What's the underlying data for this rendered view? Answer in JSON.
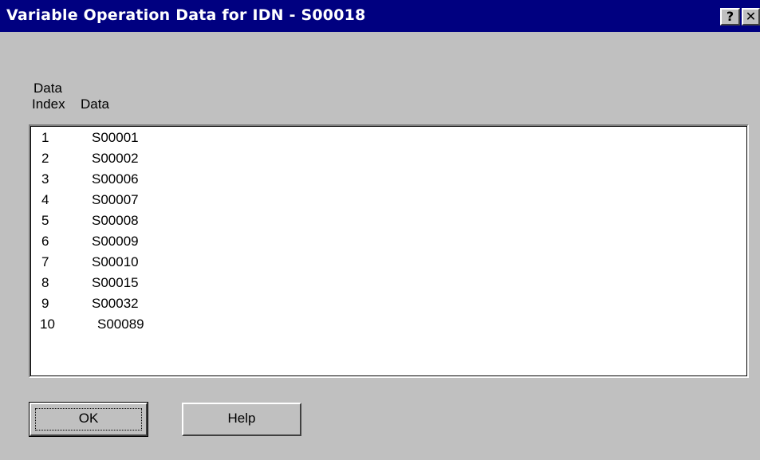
{
  "window": {
    "title": "Variable Operation Data for IDN - S00018",
    "help_glyph": "?",
    "close_glyph": "✕"
  },
  "columns": {
    "index_label_line1": "Data",
    "index_label_line2": "Index",
    "data_label": "Data"
  },
  "rows": [
    {
      "index": "1",
      "data": "S00001"
    },
    {
      "index": "2",
      "data": "S00002"
    },
    {
      "index": "3",
      "data": "S00006"
    },
    {
      "index": "4",
      "data": "S00007"
    },
    {
      "index": "5",
      "data": "S00008"
    },
    {
      "index": "6",
      "data": "S00009"
    },
    {
      "index": "7",
      "data": "S00010"
    },
    {
      "index": "8",
      "data": "S00015"
    },
    {
      "index": "9",
      "data": "S00032"
    },
    {
      "index": "10",
      "data": "S00089"
    }
  ],
  "buttons": {
    "ok_label": "OK",
    "help_label": "Help"
  },
  "colors": {
    "titlebar": "#000080",
    "face": "#c0c0c0",
    "list_background": "#ffffff"
  }
}
